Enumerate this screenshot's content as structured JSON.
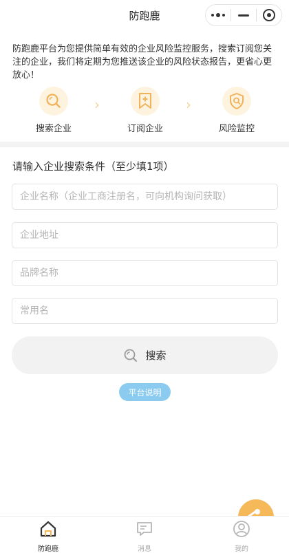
{
  "header": {
    "title": "防跑鹿"
  },
  "capsule": {
    "more_icon": "more-dots-icon",
    "minimize_icon": "minimize-icon",
    "close_icon": "target-close-icon"
  },
  "intro": {
    "text": "防跑鹿平台为您提供简单有效的企业风险监控服务，搜索订阅您关注的企业，我们将定期为您推送该企业的风险状态报告，更省心更放心！"
  },
  "steps": [
    {
      "label": "搜索企业",
      "icon": "search-icon"
    },
    {
      "label": "订阅企业",
      "icon": "bookmark-plus-icon"
    },
    {
      "label": "风险监控",
      "icon": "shield-search-icon"
    }
  ],
  "form": {
    "title": "请输入企业搜索条件（至少填1项）",
    "fields": [
      {
        "value": "",
        "placeholder": "企业名称（企业工商注册名，可向机构询问获取）"
      },
      {
        "value": "",
        "placeholder": "企业地址"
      },
      {
        "value": "",
        "placeholder": "品牌名称"
      },
      {
        "value": "",
        "placeholder": "常用名"
      }
    ],
    "search_label": "搜索",
    "help_label": "平台说明"
  },
  "tabbar": {
    "items": [
      {
        "label": "防跑鹿",
        "icon": "home-icon",
        "active": true
      },
      {
        "label": "消息",
        "icon": "message-icon",
        "active": false
      },
      {
        "label": "我的",
        "icon": "user-icon",
        "active": false
      }
    ]
  },
  "colors": {
    "accent": "#f5b95a",
    "icon_bg": "#fdf3df",
    "help": "#8bcbf0"
  }
}
